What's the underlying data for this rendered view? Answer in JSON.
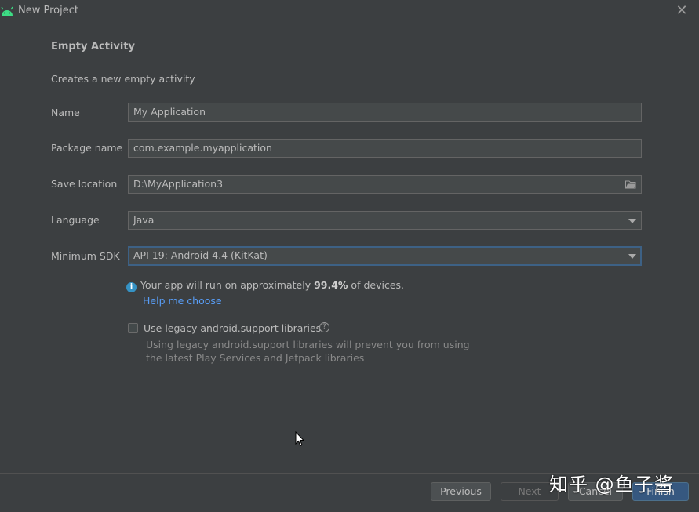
{
  "window": {
    "title": "New Project"
  },
  "header": {
    "heading": "Empty Activity",
    "subheading": "Creates a new empty activity"
  },
  "form": {
    "name": {
      "label": "Name",
      "value": "My Application"
    },
    "package_name": {
      "label": "Package name",
      "value": "com.example.myapplication"
    },
    "save_location": {
      "label": "Save location",
      "value": "D:\\MyApplication3"
    },
    "language": {
      "label": "Language",
      "value": "Java"
    },
    "minimum_sdk": {
      "label": "Minimum SDK",
      "value": "API 19: Android 4.4 (KitKat)"
    }
  },
  "info": {
    "prefix": "Your app will run on approximately ",
    "percent": "99.4%",
    "suffix": " of devices.",
    "help_link": "Help me choose"
  },
  "legacy": {
    "label": "Use legacy android.support libraries",
    "checked": false,
    "desc_line1": "Using legacy android.support libraries will prevent you from using",
    "desc_line2": "the latest Play Services and Jetpack libraries"
  },
  "buttons": {
    "previous": "Previous",
    "next": "Next",
    "cancel": "Cancel",
    "finish": "Finish"
  },
  "watermark": "知乎 @鱼子酱",
  "colors": {
    "background": "#3c3f41",
    "link": "#589df6",
    "info_icon": "#3592c4",
    "android_green": "#3ddc84",
    "primary_button": "#365880",
    "focus_border": "#3d6185"
  }
}
